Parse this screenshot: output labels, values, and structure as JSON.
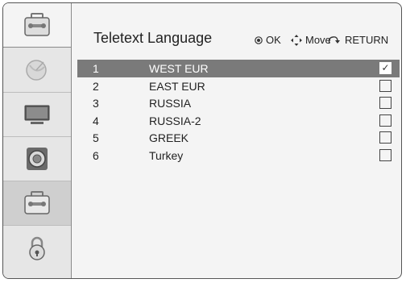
{
  "header": {
    "title": "Teletext Language",
    "ok_label": "OK",
    "move_label": "Move",
    "return_label": "RETURN",
    "ok_icon": "ok-button-icon",
    "move_icon": "move-arrows-icon",
    "return_icon": "return-arrow-icon"
  },
  "sidebar": {
    "items": [
      {
        "name": "option-tool",
        "icon": "toolbox-icon",
        "active": false
      },
      {
        "name": "setup",
        "icon": "satellite-dish-icon",
        "active": false
      },
      {
        "name": "picture",
        "icon": "monitor-icon",
        "active": false
      },
      {
        "name": "audio",
        "icon": "speaker-icon",
        "active": false
      },
      {
        "name": "option",
        "icon": "toolbox-icon",
        "active": true
      },
      {
        "name": "lock",
        "icon": "padlock-icon",
        "active": false
      }
    ]
  },
  "languages": [
    {
      "num": "1",
      "label": "WEST EUR",
      "checked": true,
      "check_mark": "✓"
    },
    {
      "num": "2",
      "label": "EAST EUR",
      "checked": false,
      "check_mark": ""
    },
    {
      "num": "3",
      "label": "RUSSIA",
      "checked": false,
      "check_mark": ""
    },
    {
      "num": "4",
      "label": "RUSSIA-2",
      "checked": false,
      "check_mark": ""
    },
    {
      "num": "5",
      "label": "GREEK",
      "checked": false,
      "check_mark": ""
    },
    {
      "num": "6",
      "label": "Turkey",
      "checked": false,
      "check_mark": ""
    }
  ],
  "colors": {
    "selected_row": "#7a7a7a",
    "frame_border": "#555555"
  }
}
